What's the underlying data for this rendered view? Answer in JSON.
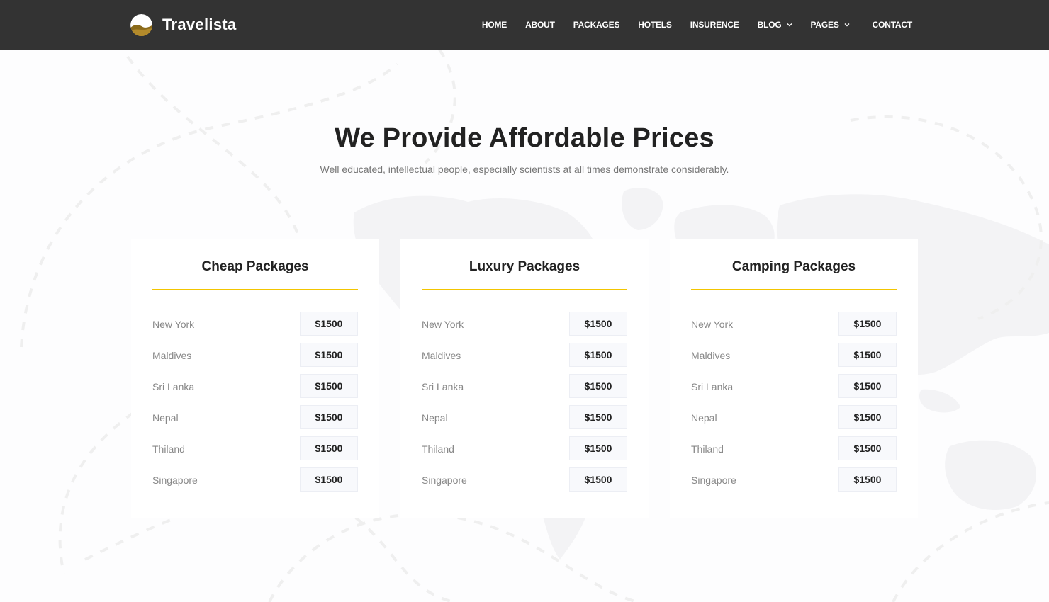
{
  "brand": {
    "name": "Travelista",
    "logo_icon": "sunset-hill-icon"
  },
  "nav": {
    "items": [
      {
        "label": "HOME",
        "dropdown": false
      },
      {
        "label": "ABOUT",
        "dropdown": false
      },
      {
        "label": "PACKAGES",
        "dropdown": false
      },
      {
        "label": "HOTELS",
        "dropdown": false
      },
      {
        "label": "INSURENCE",
        "dropdown": false
      },
      {
        "label": "BLOG",
        "dropdown": true
      },
      {
        "label": "PAGES",
        "dropdown": true
      },
      {
        "label": "CONTACT",
        "dropdown": false
      }
    ]
  },
  "section": {
    "title": "We Provide Affordable Prices",
    "subtitle": "Well educated, intellectual people, especially scientists at all times demonstrate considerably."
  },
  "cards": [
    {
      "title": "Cheap Packages",
      "rows": [
        {
          "destination": "New York",
          "price": "$1500"
        },
        {
          "destination": "Maldives",
          "price": "$1500"
        },
        {
          "destination": "Sri Lanka",
          "price": "$1500"
        },
        {
          "destination": "Nepal",
          "price": "$1500"
        },
        {
          "destination": "Thiland",
          "price": "$1500"
        },
        {
          "destination": "Singapore",
          "price": "$1500"
        }
      ]
    },
    {
      "title": "Luxury Packages",
      "rows": [
        {
          "destination": "New York",
          "price": "$1500"
        },
        {
          "destination": "Maldives",
          "price": "$1500"
        },
        {
          "destination": "Sri Lanka",
          "price": "$1500"
        },
        {
          "destination": "Nepal",
          "price": "$1500"
        },
        {
          "destination": "Thiland",
          "price": "$1500"
        },
        {
          "destination": "Singapore",
          "price": "$1500"
        }
      ]
    },
    {
      "title": "Camping Packages",
      "rows": [
        {
          "destination": "New York",
          "price": "$1500"
        },
        {
          "destination": "Maldives",
          "price": "$1500"
        },
        {
          "destination": "Sri Lanka",
          "price": "$1500"
        },
        {
          "destination": "Nepal",
          "price": "$1500"
        },
        {
          "destination": "Thiland",
          "price": "$1500"
        },
        {
          "destination": "Singapore",
          "price": "$1500"
        }
      ]
    }
  ],
  "colors": {
    "navbar": "#333333",
    "accent": "#f2c500",
    "page_bg": "#fdfdfe",
    "card_bg": "#ffffff",
    "price_bg": "#f8f9fc",
    "map_tint": "#f3f4f6"
  }
}
